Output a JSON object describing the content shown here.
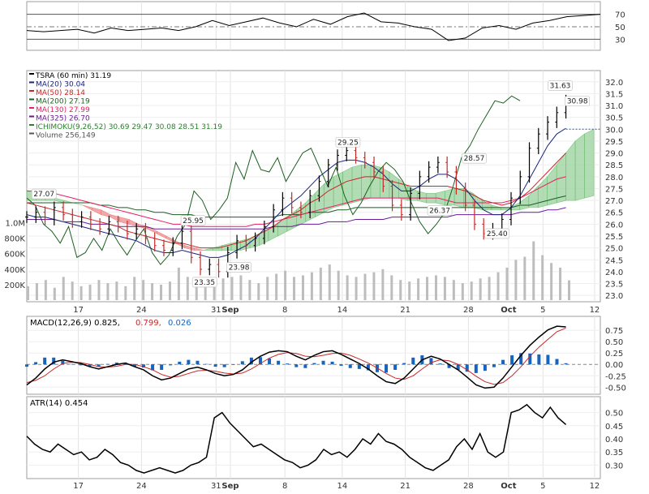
{
  "chart_data": [
    {
      "type": "line",
      "panel": "rsi",
      "y_ticks": [
        "70",
        "50",
        "30"
      ],
      "y_values": [
        70,
        50,
        30
      ],
      "ylim": [
        15,
        85
      ],
      "series": [
        {
          "x": [
            0,
            20,
            40,
            60,
            80,
            100,
            120,
            140,
            160,
            180,
            200,
            220,
            240,
            260,
            280,
            300,
            320,
            340,
            360,
            380,
            400,
            420,
            440,
            460,
            480,
            500,
            520,
            540,
            560,
            580,
            600,
            620,
            640,
            660,
            680
          ],
          "values": [
            44,
            42,
            44,
            46,
            40,
            48,
            44,
            46,
            48,
            44,
            50,
            60,
            52,
            58,
            64,
            56,
            50,
            62,
            54,
            66,
            72,
            58,
            56,
            50,
            46,
            28,
            32,
            48,
            52,
            46,
            56,
            60,
            66,
            68,
            70
          ]
        }
      ],
      "colors": {
        "line": "#000000",
        "above": "#2e7d32",
        "below": "#b71c1c"
      }
    },
    {
      "type": "line",
      "panel": "price",
      "legend": [
        {
          "label": "TSRA (60 min) 31.19",
          "color": "#000000"
        },
        {
          "label": "MA(20) 30.04",
          "color": "#1a237e"
        },
        {
          "label": "MA(50) 28.14",
          "color": "#c62828"
        },
        {
          "label": "MA(200) 27.19",
          "color": "#1b5e20"
        },
        {
          "label": "MA(130) 27.99",
          "color": "#e91e63"
        },
        {
          "label": "MA(325) 26.70",
          "color": "#6a1b9a"
        },
        {
          "label": "ICHIMOKU(9,26,52) 30.69 29.47 30.08 28.51 31.19",
          "color": "#2e7d32"
        },
        {
          "label": "Volume 256,149",
          "color": "#555555"
        }
      ],
      "y_ticks": [
        "32.0",
        "31.5",
        "31.0",
        "30.5",
        "30.0",
        "29.5",
        "29.0",
        "28.5",
        "28.0",
        "27.5",
        "27.0",
        "26.5",
        "26.0",
        "25.5",
        "25.0",
        "24.5",
        "24.0",
        "23.5",
        "23.0"
      ],
      "y_values": [
        32.0,
        31.5,
        31.0,
        30.5,
        30.0,
        29.5,
        29.0,
        28.5,
        28.0,
        27.5,
        27.0,
        26.5,
        26.0,
        25.5,
        25.0,
        24.5,
        24.0,
        23.5,
        23.0
      ],
      "ylim": [
        22.8,
        32.3
      ],
      "volume_ticks": [
        "1.0M",
        "800K",
        "600K",
        "400K",
        "200K"
      ],
      "volume_values": [
        1000000,
        800000,
        600000,
        400000,
        200000
      ],
      "x_ticks": [
        "17",
        "24",
        "31",
        "Sep",
        "8",
        "14",
        "21",
        "28",
        "Oct",
        "5",
        "12"
      ],
      "x_positions": [
        0.09,
        0.2,
        0.33,
        0.355,
        0.45,
        0.55,
        0.66,
        0.77,
        0.84,
        0.9,
        0.99
      ],
      "annotations": [
        {
          "text": "27.07",
          "x": 0.03,
          "y": 27.07
        },
        {
          "text": "25.95",
          "x": 0.29,
          "y": 25.95
        },
        {
          "text": "23.35",
          "x": 0.31,
          "y": 23.35
        },
        {
          "text": "23.98",
          "x": 0.37,
          "y": 23.98
        },
        {
          "text": "29.25",
          "x": 0.56,
          "y": 29.25
        },
        {
          "text": "28.57",
          "x": 0.78,
          "y": 28.57
        },
        {
          "text": "26.37",
          "x": 0.72,
          "y": 26.37
        },
        {
          "text": "25.40",
          "x": 0.82,
          "y": 25.4
        },
        {
          "text": "31.63",
          "x": 0.93,
          "y": 31.63
        },
        {
          "text": "30.98",
          "x": 0.96,
          "y": 30.98
        }
      ],
      "price": [
        26.3,
        26.5,
        26.2,
        26.7,
        26.4,
        26.1,
        26.3,
        26.0,
        25.8,
        26.1,
        25.9,
        25.6,
        25.8,
        25.4,
        25.1,
        24.9,
        25.2,
        25.7,
        24.6,
        24.1,
        24.3,
        24.0,
        24.8,
        25.3,
        25.1,
        25.4,
        25.9,
        26.6,
        27.1,
        26.7,
        26.5,
        27.2,
        27.8,
        28.5,
        28.9,
        29.1,
        28.8,
        28.6,
        28.2,
        27.6,
        26.8,
        26.4,
        27.3,
        28.0,
        28.4,
        28.6,
        28.2,
        27.5,
        26.8,
        26.0,
        25.6,
        25.8,
        26.2,
        27.1,
        28.0,
        29.2,
        29.8,
        30.3,
        30.7,
        31.2
      ],
      "ma20": [
        26.4,
        26.3,
        26.3,
        26.2,
        26.1,
        26.0,
        25.9,
        25.8,
        25.7,
        25.6,
        25.5,
        25.4,
        25.3,
        25.1,
        24.9,
        24.8,
        24.8,
        24.9,
        24.8,
        24.7,
        24.6,
        24.6,
        24.7,
        24.9,
        25.1,
        25.4,
        25.8,
        26.2,
        26.6,
        26.9,
        27.2,
        27.6,
        28.0,
        28.3,
        28.6,
        28.7,
        28.7,
        28.6,
        28.4,
        28.1,
        27.7,
        27.4,
        27.4,
        27.6,
        27.9,
        28.1,
        28.1,
        27.9,
        27.5,
        27.0,
        26.6,
        26.4,
        26.4,
        26.7,
        27.2,
        27.9,
        28.6,
        29.3,
        29.8,
        30.04
      ],
      "ma50": [
        26.9,
        26.8,
        26.7,
        26.6,
        26.5,
        26.4,
        26.3,
        26.2,
        26.1,
        26.0,
        25.9,
        25.7,
        25.6,
        25.5,
        25.4,
        25.3,
        25.2,
        25.2,
        25.1,
        25.0,
        25.0,
        25.0,
        25.1,
        25.2,
        25.3,
        25.5,
        25.7,
        25.9,
        26.2,
        26.4,
        26.6,
        26.9,
        27.1,
        27.4,
        27.6,
        27.8,
        27.9,
        28.0,
        28.0,
        27.9,
        27.8,
        27.7,
        27.6,
        27.6,
        27.6,
        27.6,
        27.6,
        27.5,
        27.4,
        27.2,
        27.0,
        26.9,
        26.8,
        26.9,
        27.1,
        27.4,
        27.8,
        28.2,
        28.6,
        29.0
      ],
      "ma130": [
        27.4,
        27.4,
        27.3,
        27.3,
        27.2,
        27.1,
        27.0,
        26.9,
        26.8,
        26.7,
        26.6,
        26.5,
        26.4,
        26.3,
        26.2,
        26.1,
        26.0,
        26.0,
        25.9,
        25.9,
        25.9,
        25.9,
        25.9,
        25.9,
        25.9,
        26.0,
        26.0,
        26.1,
        26.2,
        26.3,
        26.4,
        26.5,
        26.6,
        26.7,
        26.8,
        26.9,
        27.0,
        27.1,
        27.1,
        27.1,
        27.1,
        27.1,
        27.1,
        27.1,
        27.1,
        27.1,
        27.0,
        26.9,
        26.9,
        26.9,
        26.9,
        26.9,
        26.9,
        27.0,
        27.1,
        27.3,
        27.5,
        27.7,
        27.9,
        28.0
      ],
      "ma200": [
        26.9,
        26.9,
        26.9,
        26.9,
        26.9,
        26.9,
        26.9,
        26.9,
        26.8,
        26.8,
        26.7,
        26.7,
        26.6,
        26.6,
        26.5,
        26.5,
        26.4,
        26.4,
        26.4,
        26.3,
        26.3,
        26.3,
        26.3,
        26.3,
        26.3,
        26.3,
        26.3,
        26.3,
        26.4,
        26.4,
        26.4,
        26.5,
        26.5,
        26.5,
        26.6,
        26.6,
        26.7,
        26.7,
        26.7,
        26.7,
        26.7,
        26.7,
        26.7,
        26.7,
        26.7,
        26.7,
        26.7,
        26.7,
        26.7,
        26.7,
        26.7,
        26.7,
        26.7,
        26.7,
        26.8,
        26.8,
        26.9,
        27.0,
        27.1,
        27.19
      ],
      "ma325": [
        26.2,
        26.2,
        26.2,
        26.2,
        26.1,
        26.1,
        26.1,
        26.0,
        26.0,
        26.0,
        25.9,
        25.9,
        25.9,
        25.9,
        25.8,
        25.8,
        25.8,
        25.8,
        25.8,
        25.8,
        25.8,
        25.8,
        25.8,
        25.8,
        25.8,
        25.8,
        25.8,
        25.9,
        25.9,
        25.9,
        26.0,
        26.0,
        26.0,
        26.1,
        26.1,
        26.1,
        26.2,
        26.2,
        26.2,
        26.2,
        26.3,
        26.3,
        26.3,
        26.3,
        26.3,
        26.3,
        26.3,
        26.4,
        26.4,
        26.4,
        26.4,
        26.4,
        26.4,
        26.4,
        26.5,
        26.5,
        26.5,
        26.6,
        26.6,
        26.7
      ],
      "chikou": [
        27.1,
        26.8,
        26.0,
        25.7,
        25.2,
        25.9,
        24.6,
        24.8,
        25.4,
        24.9,
        25.8,
        25.2,
        24.7,
        25.3,
        25.8,
        24.8,
        24.3,
        24.7,
        25.5,
        26.0,
        27.4,
        27.0,
        26.2,
        26.6,
        27.1,
        28.6,
        27.9,
        29.1,
        28.3,
        28.2,
        28.8,
        27.8,
        28.4,
        29.0,
        29.2,
        28.4,
        27.6,
        28.4,
        27.2,
        26.4,
        26.9,
        27.6,
        28.2,
        28.6,
        28.3,
        27.8,
        26.9,
        26.1,
        25.6,
        26.0,
        26.5,
        27.6,
        28.8,
        29.3,
        30.0,
        30.6,
        31.2,
        31.1,
        31.4,
        31.2
      ],
      "chikou_len": 50,
      "cloud_a": [
        27.4,
        27.3,
        27.2,
        27.1,
        27.0,
        26.9,
        26.8,
        26.6,
        26.4,
        26.3,
        26.1,
        26.0,
        25.9,
        25.8,
        25.6,
        25.4,
        25.2,
        25.0,
        24.9,
        24.9,
        25.0,
        25.1,
        25.2,
        25.3,
        25.4,
        25.6,
        25.8,
        26.0,
        26.3,
        26.6,
        26.9,
        27.3,
        27.7,
        28.0,
        28.2,
        28.4,
        28.5,
        28.5,
        28.4,
        28.2,
        27.9,
        27.6,
        27.4,
        27.3,
        27.3,
        27.4,
        27.5,
        27.5,
        27.3,
        27.0,
        26.8,
        26.7,
        26.7,
        26.9,
        27.2,
        27.6,
        28.0,
        28.5,
        29.0,
        29.5,
        29.8,
        30.0
      ],
      "cloud_b": [
        27.0,
        27.0,
        27.0,
        27.0,
        26.9,
        26.9,
        26.8,
        26.7,
        26.6,
        26.4,
        26.3,
        26.2,
        26.0,
        25.9,
        25.7,
        25.5,
        25.3,
        25.1,
        25.0,
        24.9,
        24.9,
        24.9,
        24.9,
        24.9,
        25.0,
        25.1,
        25.3,
        25.5,
        25.7,
        25.9,
        26.1,
        26.3,
        26.5,
        26.7,
        26.8,
        26.9,
        27.0,
        27.1,
        27.1,
        27.1,
        27.1,
        27.0,
        27.0,
        26.9,
        26.9,
        26.8,
        26.8,
        26.7,
        26.7,
        26.6,
        26.6,
        26.6,
        26.6,
        26.6,
        26.7,
        26.7,
        26.8,
        26.9,
        27.0,
        27.0,
        27.1,
        27.2
      ],
      "volume": [
        180000,
        220000,
        260000,
        160000,
        300000,
        240000,
        180000,
        200000,
        260000,
        220000,
        240000,
        180000,
        300000,
        260000,
        220000,
        200000,
        240000,
        420000,
        300000,
        260000,
        200000,
        240000,
        280000,
        300000,
        320000,
        260000,
        220000,
        300000,
        340000,
        380000,
        300000,
        320000,
        360000,
        420000,
        460000,
        380000,
        320000,
        300000,
        340000,
        360000,
        400000,
        320000,
        260000,
        240000,
        280000,
        300000,
        320000,
        300000,
        260000,
        220000,
        240000,
        280000,
        300000,
        360000,
        420000,
        520000,
        560000,
        760000,
        580000,
        480000,
        420000,
        256149
      ]
    },
    {
      "type": "line",
      "panel": "macd",
      "legend": [
        {
          "label": "MACD(12,26,9) 0.825,",
          "color": "#000000"
        },
        {
          "label": "0.799,",
          "color": "#c62828"
        },
        {
          "label": "0.026",
          "color": "#1565c0"
        }
      ],
      "y_ticks": [
        "0.75",
        "0.50",
        "0.25",
        "0.00",
        "-0.25",
        "-0.50"
      ],
      "y_values": [
        0.75,
        0.5,
        0.25,
        0.0,
        -0.25,
        -0.5
      ],
      "ylim": [
        -0.62,
        0.95
      ],
      "macd": [
        -0.45,
        -0.3,
        -0.1,
        0.05,
        0.1,
        0.06,
        0.02,
        -0.05,
        -0.1,
        -0.05,
        0.0,
        0.03,
        -0.05,
        -0.12,
        -0.25,
        -0.34,
        -0.3,
        -0.2,
        -0.1,
        -0.06,
        -0.12,
        -0.2,
        -0.25,
        -0.22,
        -0.12,
        0.05,
        0.18,
        0.27,
        0.3,
        0.28,
        0.18,
        0.1,
        0.2,
        0.28,
        0.3,
        0.22,
        0.12,
        0.02,
        -0.1,
        -0.25,
        -0.38,
        -0.42,
        -0.3,
        -0.1,
        0.1,
        0.18,
        0.12,
        0.0,
        -0.12,
        -0.28,
        -0.45,
        -0.52,
        -0.5,
        -0.3,
        -0.05,
        0.2,
        0.42,
        0.6,
        0.76,
        0.84,
        0.825
      ],
      "signal": [
        -0.4,
        -0.35,
        -0.25,
        -0.1,
        0.02,
        0.05,
        0.04,
        0.0,
        -0.05,
        -0.06,
        -0.04,
        0.0,
        0.0,
        -0.05,
        -0.12,
        -0.22,
        -0.28,
        -0.26,
        -0.2,
        -0.14,
        -0.13,
        -0.15,
        -0.19,
        -0.21,
        -0.19,
        -0.1,
        0.02,
        0.14,
        0.22,
        0.26,
        0.24,
        0.18,
        0.17,
        0.2,
        0.24,
        0.25,
        0.2,
        0.12,
        0.03,
        -0.08,
        -0.2,
        -0.3,
        -0.33,
        -0.25,
        -0.1,
        0.04,
        0.1,
        0.08,
        0.0,
        -0.12,
        -0.26,
        -0.38,
        -0.44,
        -0.4,
        -0.25,
        -0.05,
        0.18,
        0.38,
        0.55,
        0.72,
        0.799
      ],
      "hist_color": "#1565c0"
    },
    {
      "type": "line",
      "panel": "atr",
      "legend": [
        {
          "label": "ATR(14) 0.454",
          "color": "#000000"
        }
      ],
      "y_ticks": [
        "0.50",
        "0.45",
        "0.40",
        "0.35",
        "0.30"
      ],
      "y_values": [
        0.5,
        0.45,
        0.4,
        0.35,
        0.3
      ],
      "ylim": [
        0.255,
        0.545
      ],
      "series": [
        {
          "values": [
            0.41,
            0.38,
            0.36,
            0.35,
            0.38,
            0.36,
            0.34,
            0.35,
            0.32,
            0.33,
            0.36,
            0.34,
            0.31,
            0.3,
            0.28,
            0.27,
            0.28,
            0.29,
            0.28,
            0.27,
            0.28,
            0.3,
            0.31,
            0.33,
            0.48,
            0.5,
            0.46,
            0.43,
            0.4,
            0.37,
            0.38,
            0.36,
            0.34,
            0.32,
            0.31,
            0.29,
            0.3,
            0.32,
            0.36,
            0.34,
            0.35,
            0.33,
            0.36,
            0.4,
            0.38,
            0.42,
            0.39,
            0.38,
            0.36,
            0.33,
            0.31,
            0.29,
            0.28,
            0.3,
            0.32,
            0.37,
            0.4,
            0.36,
            0.42,
            0.35,
            0.33,
            0.35,
            0.5,
            0.51,
            0.53,
            0.5,
            0.48,
            0.52,
            0.48,
            0.454
          ]
        }
      ],
      "x_ticks": [
        "17",
        "24",
        "31",
        "Sep",
        "8",
        "14",
        "21",
        "28",
        "Oct",
        "5",
        "12"
      ]
    }
  ]
}
